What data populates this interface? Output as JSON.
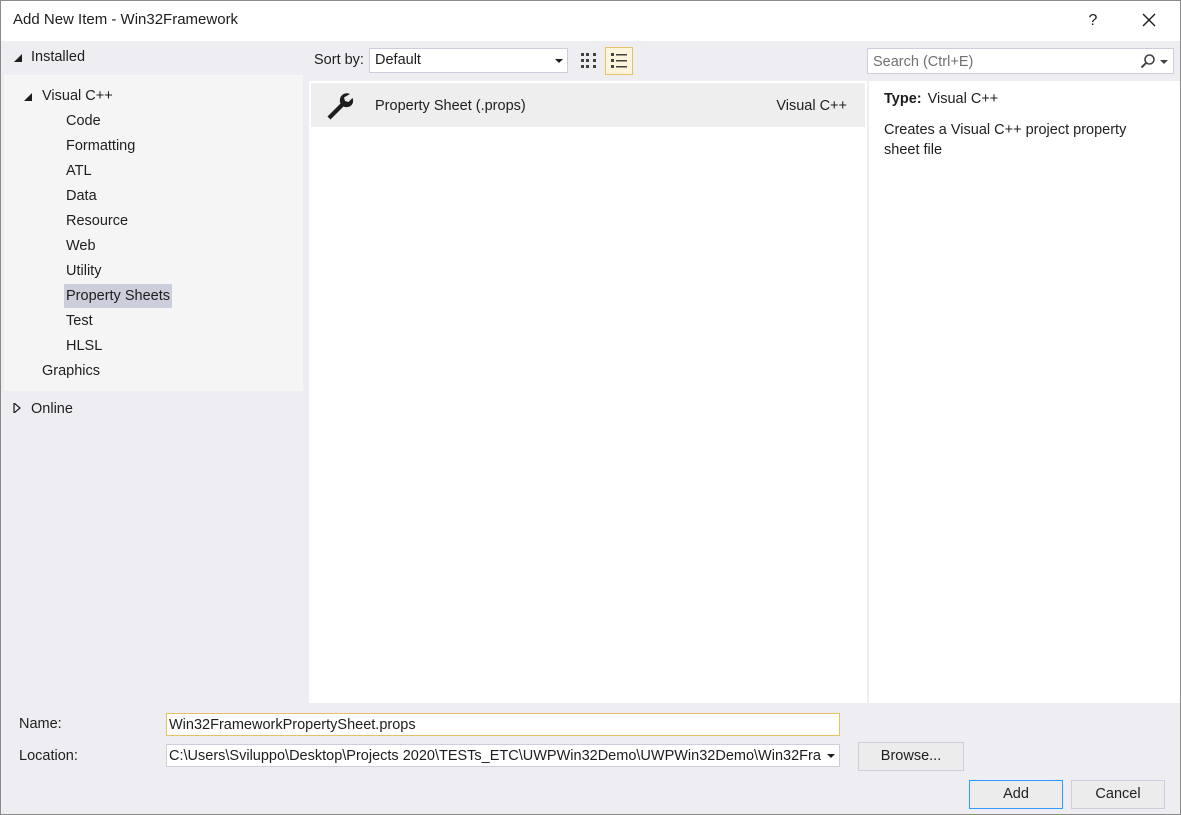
{
  "window": {
    "title": "Add New Item - Win32Framework",
    "help_label": "?"
  },
  "tree": {
    "installed_label": "Installed",
    "visual_cpp_label": "Visual C++",
    "children": [
      "Code",
      "Formatting",
      "ATL",
      "Data",
      "Resource",
      "Web",
      "Utility",
      "Property Sheets",
      "Test",
      "HLSL"
    ],
    "selected": "Property Sheets",
    "graphics_label": "Graphics",
    "online_label": "Online"
  },
  "toolbar": {
    "sort_label": "Sort by:",
    "sort_value": "Default",
    "search_placeholder": "Search (Ctrl+E)"
  },
  "templates": [
    {
      "name": "Property Sheet (.props)",
      "language": "Visual C++"
    }
  ],
  "details": {
    "type_label": "Type:",
    "type_value": "Visual C++",
    "description": "Creates a Visual C++ project property sheet file"
  },
  "form": {
    "name_label": "Name:",
    "name_value": "Win32FrameworkPropertySheet.props",
    "location_label": "Location:",
    "location_value": "C:\\Users\\Sviluppo\\Desktop\\Projects 2020\\TESTs_ETC\\UWPWin32Demo\\UWPWin32Demo\\Win32Fra",
    "browse_label": "Browse...",
    "add_label": "Add",
    "cancel_label": "Cancel"
  },
  "colors": {
    "dialog_bg": "#eeeef2",
    "selection": "#cccedb",
    "accent_border": "#3399ff",
    "active_view_bg": "#fcf4dc"
  }
}
